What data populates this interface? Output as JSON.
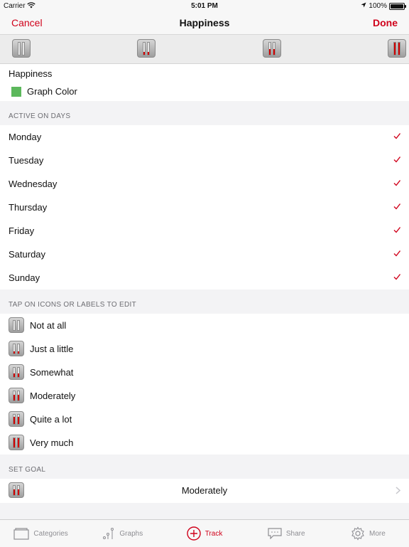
{
  "status": {
    "carrier": "Carrier",
    "time": "5:01 PM",
    "battery": "100%"
  },
  "nav": {
    "cancel": "Cancel",
    "title": "Happiness",
    "done": "Done"
  },
  "icon_strip": {
    "levels": [
      0,
      0.25,
      0.5,
      1.0
    ]
  },
  "category": {
    "name": "Happiness",
    "graph_color_label": "Graph Color",
    "graph_color": "#5cb85c"
  },
  "active_days": {
    "header": "ACTIVE ON DAYS",
    "days": [
      {
        "label": "Monday",
        "checked": true
      },
      {
        "label": "Tuesday",
        "checked": true
      },
      {
        "label": "Wednesday",
        "checked": true
      },
      {
        "label": "Thursday",
        "checked": true
      },
      {
        "label": "Friday",
        "checked": true
      },
      {
        "label": "Saturday",
        "checked": true
      },
      {
        "label": "Sunday",
        "checked": true
      }
    ]
  },
  "levels": {
    "header": "TAP ON ICONS OR LABELS TO EDIT",
    "items": [
      {
        "label": "Not at all",
        "level": 0
      },
      {
        "label": "Just a little",
        "level": 0.2
      },
      {
        "label": "Somewhat",
        "level": 0.4
      },
      {
        "label": "Moderately",
        "level": 0.6
      },
      {
        "label": "Quite a lot",
        "level": 0.8
      },
      {
        "label": "Very much",
        "level": 1.0
      }
    ]
  },
  "goal": {
    "header": "SET GOAL",
    "value": "Moderately",
    "level": 0.6
  },
  "tabbar": {
    "tabs": [
      {
        "label": "Categories",
        "icon": "folder-icon",
        "active": false
      },
      {
        "label": "Graphs",
        "icon": "graph-icon",
        "active": false
      },
      {
        "label": "Track",
        "icon": "plus-circle-icon",
        "active": true
      },
      {
        "label": "Share",
        "icon": "chat-bubble-icon",
        "active": false
      },
      {
        "label": "More",
        "icon": "gear-icon",
        "active": false
      }
    ]
  },
  "colors": {
    "accent": "#d0021b",
    "fill": "#d30000"
  }
}
